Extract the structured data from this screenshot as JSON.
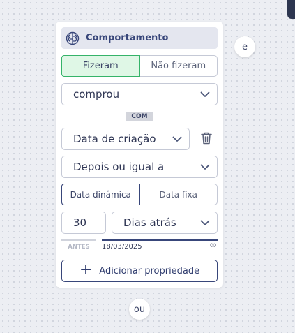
{
  "header": {
    "title": "Comportamento",
    "icon": "brain-icon"
  },
  "action_toggle": {
    "options": [
      "Fizeram",
      "Não fizeram"
    ],
    "selected": "Fizeram"
  },
  "event_select": {
    "value": "comprou"
  },
  "separator": {
    "label": "COM"
  },
  "property_select": {
    "value": "Data de criação"
  },
  "operator_select": {
    "value": "Depois ou igual a"
  },
  "date_mode_toggle": {
    "options": [
      "Data dinâmica",
      "Data fixa"
    ],
    "selected": "Data dinâmica"
  },
  "relative": {
    "amount": "30",
    "unit": "Dias atrás"
  },
  "range": {
    "before_label": "ANTES",
    "date": "18/03/2025",
    "end_symbol": "∞"
  },
  "add_property_label": "Adicionar propriedade",
  "connectors": {
    "and_label": "e",
    "or_label": "ou"
  },
  "colors": {
    "accent": "#38467a",
    "selected_green_bg": "#dff7e6",
    "selected_green_border": "#35b369"
  }
}
